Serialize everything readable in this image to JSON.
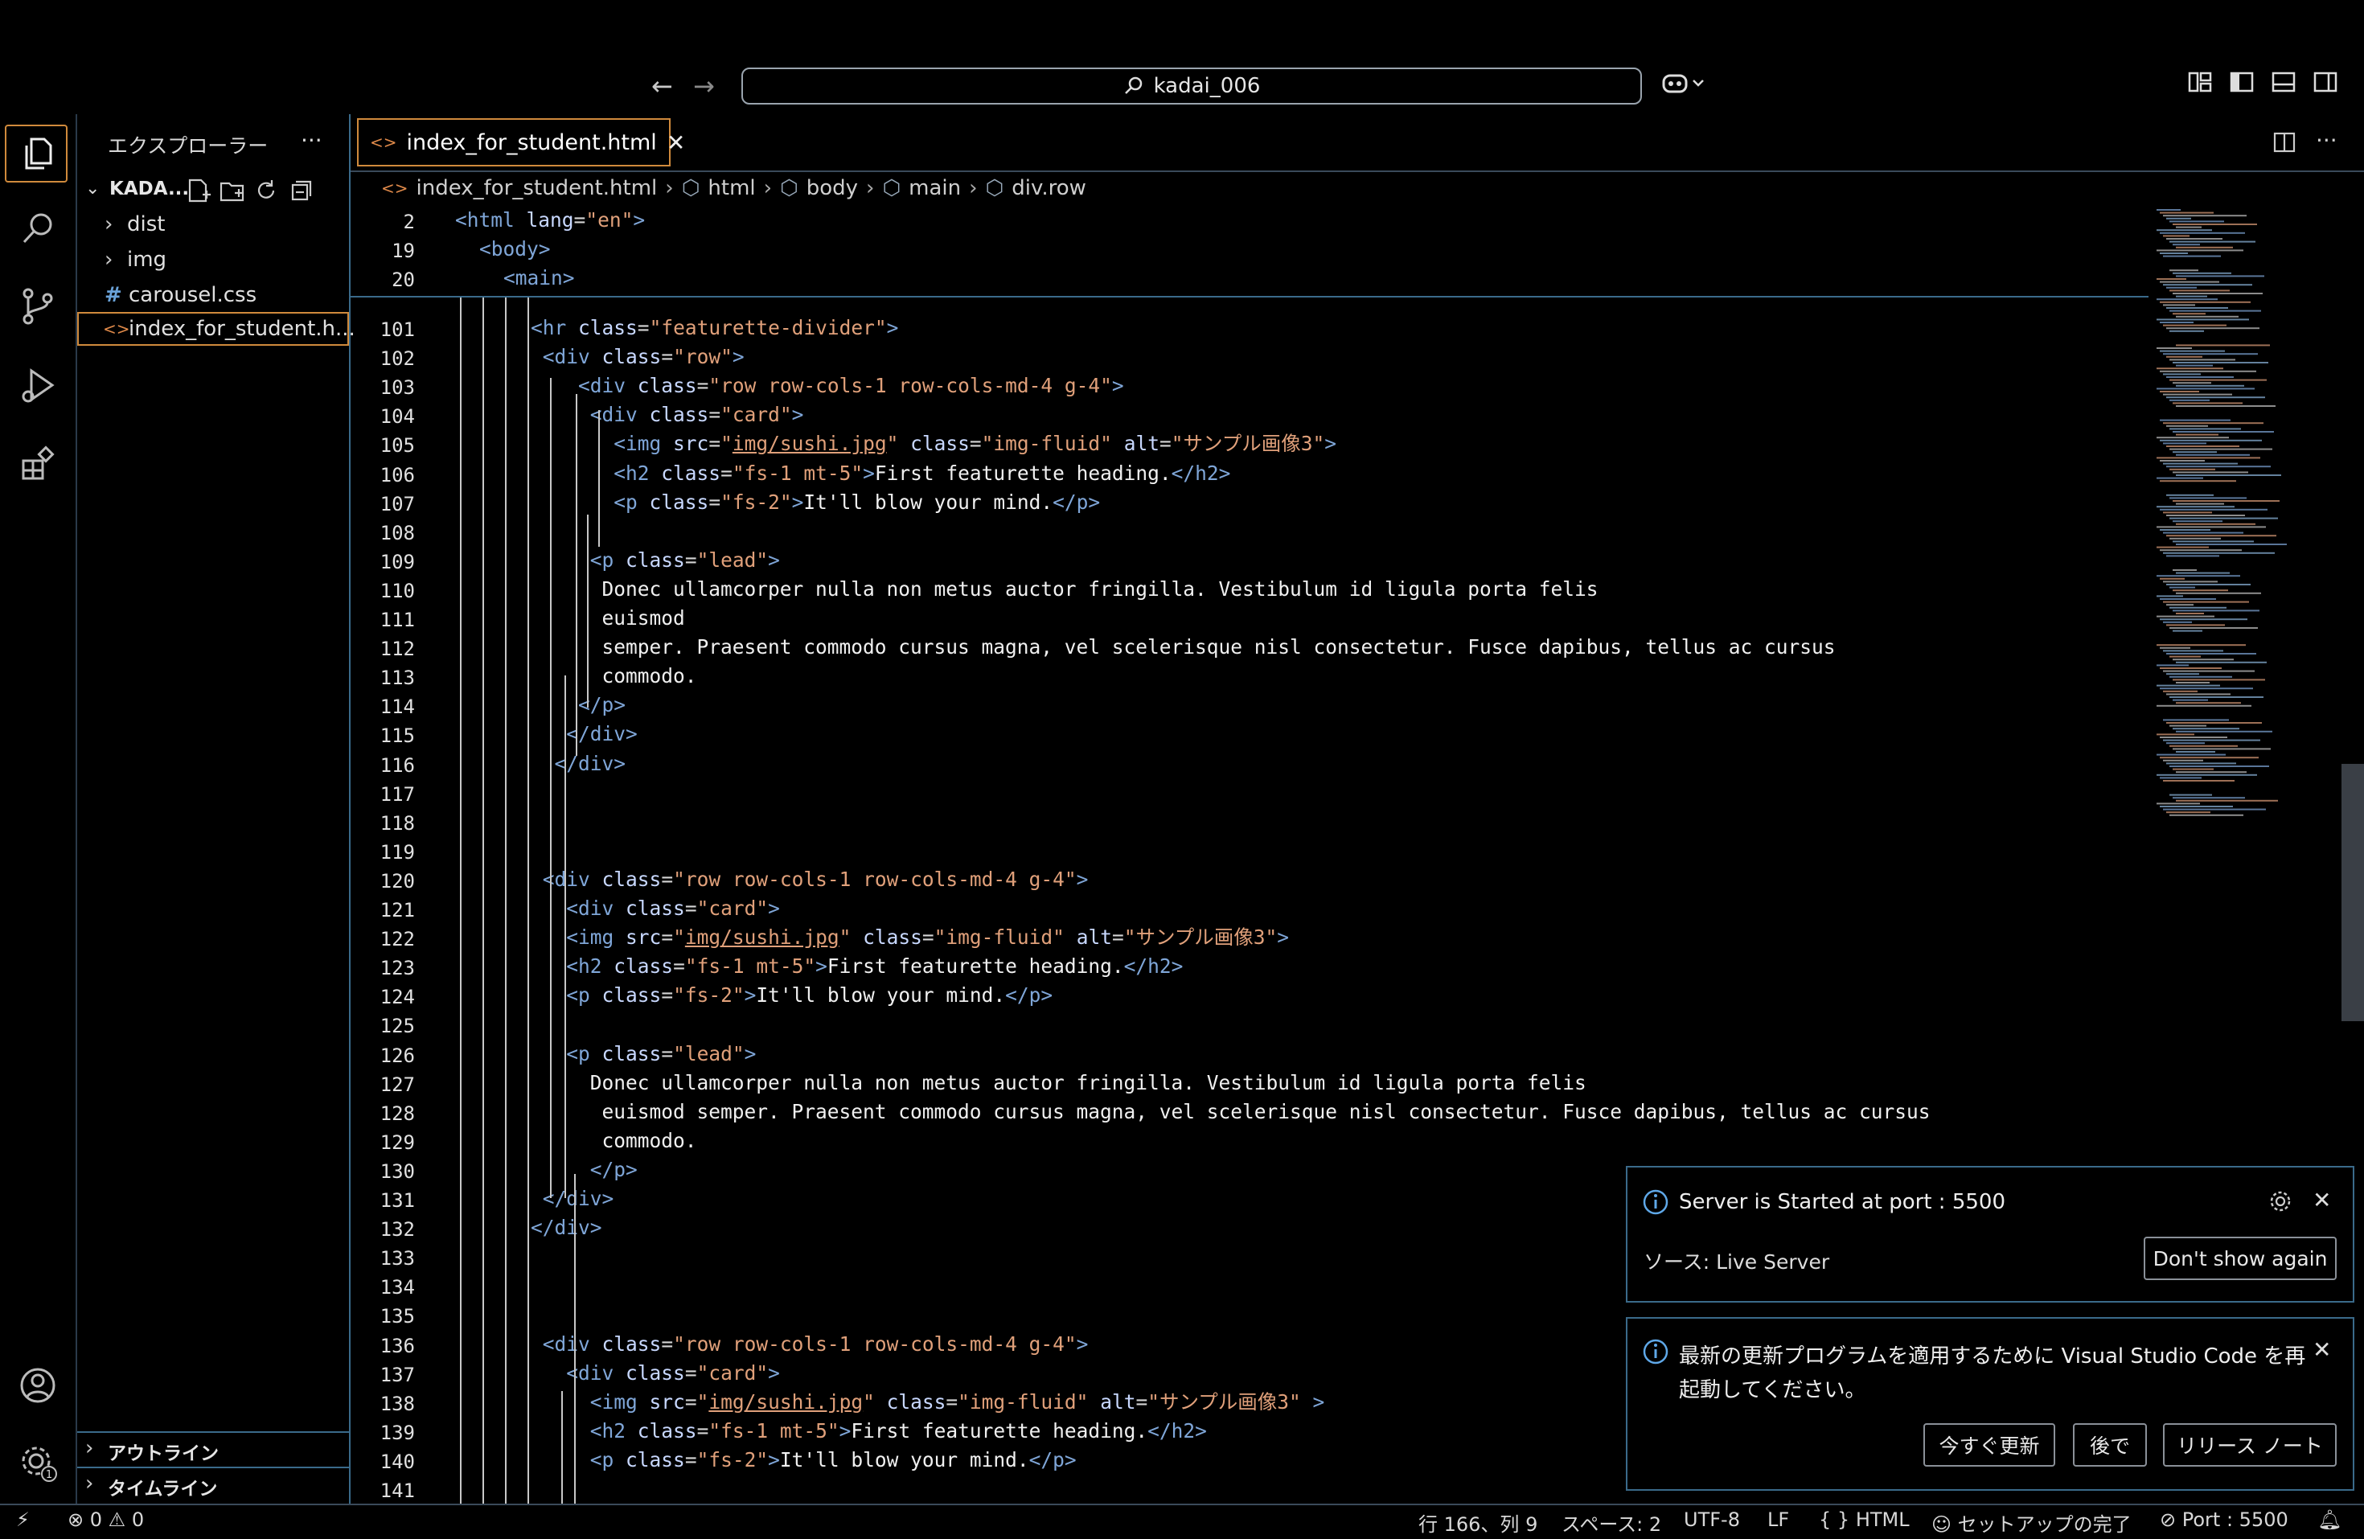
{
  "titlebar": {
    "search_text": "kadai_006"
  },
  "sidebar": {
    "title": "エクスプローラー",
    "more": "···",
    "root_folder": "KADA...",
    "items": [
      {
        "label": "dist",
        "kind": "folder"
      },
      {
        "label": "img",
        "kind": "folder"
      },
      {
        "label": "carousel.css",
        "kind": "css"
      },
      {
        "label": "index_for_student.h...",
        "kind": "html"
      }
    ],
    "outline": "アウトライン",
    "timeline": "タイムライン"
  },
  "editor": {
    "tab_label": "index_for_student.html",
    "breadcrumb": [
      "index_for_student.html",
      "html",
      "body",
      "main",
      "div.row"
    ],
    "sticky_lines": [
      {
        "n": "2",
        "indent": 0,
        "code": "<html lang=\"en\">"
      },
      {
        "n": "19",
        "indent": 1,
        "code": "<body>"
      },
      {
        "n": "20",
        "indent": 2,
        "code": "<main>"
      }
    ],
    "lines": [
      {
        "n": "101",
        "code": "<hr class=\"featurette-divider\">"
      },
      {
        "n": "102",
        "code": " <div class=\"row\">"
      },
      {
        "n": "103",
        "code": "    <div class=\"row row-cols-1 row-cols-md-4 g-4\">"
      },
      {
        "n": "104",
        "code": "     <div class=\"card\">"
      },
      {
        "n": "105",
        "code": "       <img src=\"img/sushi.jpg\" class=\"img-fluid\" alt=\"サンプル画像3\">"
      },
      {
        "n": "106",
        "code": "       <h2 class=\"fs-1 mt-5\">First featurette heading.</h2>"
      },
      {
        "n": "107",
        "code": "       <p class=\"fs-2\">It'll blow your mind.</p>"
      },
      {
        "n": "108",
        "code": ""
      },
      {
        "n": "109",
        "code": "     <p class=\"lead\">"
      },
      {
        "n": "110",
        "code": "      Donec ullamcorper nulla non metus auctor fringilla. Vestibulum id ligula porta felis"
      },
      {
        "n": "111",
        "code": "      euismod"
      },
      {
        "n": "112",
        "code": "      semper. Praesent commodo cursus magna, vel scelerisque nisl consectetur. Fusce dapibus, tellus ac cursus"
      },
      {
        "n": "113",
        "code": "      commodo."
      },
      {
        "n": "114",
        "code": "    </p>"
      },
      {
        "n": "115",
        "code": "   </div>"
      },
      {
        "n": "116",
        "code": "  </div>"
      },
      {
        "n": "117",
        "code": ""
      },
      {
        "n": "118",
        "code": ""
      },
      {
        "n": "119",
        "code": ""
      },
      {
        "n": "120",
        "code": " <div class=\"row row-cols-1 row-cols-md-4 g-4\">"
      },
      {
        "n": "121",
        "code": "   <div class=\"card\">"
      },
      {
        "n": "122",
        "code": "   <img src=\"img/sushi.jpg\" class=\"img-fluid\" alt=\"サンプル画像3\">"
      },
      {
        "n": "123",
        "code": "   <h2 class=\"fs-1 mt-5\">First featurette heading.</h2>"
      },
      {
        "n": "124",
        "code": "   <p class=\"fs-2\">It'll blow your mind.</p>"
      },
      {
        "n": "125",
        "code": ""
      },
      {
        "n": "126",
        "code": "   <p class=\"lead\">"
      },
      {
        "n": "127",
        "code": "     Donec ullamcorper nulla non metus auctor fringilla. Vestibulum id ligula porta felis"
      },
      {
        "n": "128",
        "code": "      euismod semper. Praesent commodo cursus magna, vel scelerisque nisl consectetur. Fusce dapibus, tellus ac cursus"
      },
      {
        "n": "129",
        "code": "      commodo."
      },
      {
        "n": "130",
        "code": "     </p>"
      },
      {
        "n": "131",
        "code": " </div>"
      },
      {
        "n": "132",
        "code": "</div>"
      },
      {
        "n": "133",
        "code": ""
      },
      {
        "n": "134",
        "code": ""
      },
      {
        "n": "135",
        "code": ""
      },
      {
        "n": "136",
        "code": " <div class=\"row row-cols-1 row-cols-md-4 g-4\">"
      },
      {
        "n": "137",
        "code": "   <div class=\"card\">"
      },
      {
        "n": "138",
        "code": "     <img src=\"img/sushi.jpg\" class=\"img-fluid\" alt=\"サンプル画像3\" >"
      },
      {
        "n": "139",
        "code": "     <h2 class=\"fs-1 mt-5\">First featurette heading.</h2>"
      },
      {
        "n": "140",
        "code": "     <p class=\"fs-2\">It'll blow your mind.</p>"
      },
      {
        "n": "141",
        "code": ""
      }
    ]
  },
  "notifications": {
    "server": {
      "message": "Server is Started at port : 5500",
      "source": "ソース: Live Server",
      "button": "Don't show again"
    },
    "update": {
      "message_line1": "最新の更新プログラムを適用するために Visual Studio Code を再",
      "message_line2": "起動してください。",
      "btn_update": "今すぐ更新",
      "btn_later": "後で",
      "btn_notes": "リリース ノート"
    }
  },
  "statusbar": {
    "errors": "0",
    "warnings": "0",
    "position": "行 166、列 9",
    "spaces": "スペース: 2",
    "encoding": "UTF-8",
    "eol": "LF",
    "language": "HTML",
    "copilot": "セットアップの完了",
    "port": "Port : 5500"
  },
  "colors": {
    "accent": "#d08a3c",
    "border": "#3a6a8a",
    "tag": "#7fa6d8",
    "string": "#e0a07a"
  }
}
